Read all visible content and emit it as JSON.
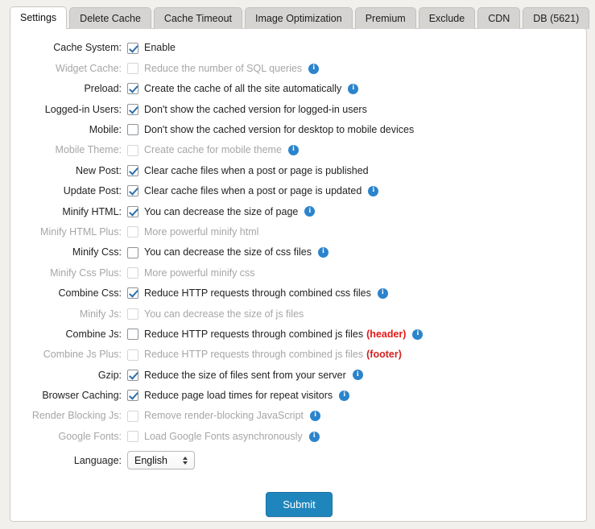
{
  "tabs": [
    {
      "label": "Settings",
      "active": true
    },
    {
      "label": "Delete Cache",
      "active": false
    },
    {
      "label": "Cache Timeout",
      "active": false
    },
    {
      "label": "Image Optimization",
      "active": false
    },
    {
      "label": "Premium",
      "active": false
    },
    {
      "label": "Exclude",
      "active": false
    },
    {
      "label": "CDN",
      "active": false
    },
    {
      "label": "DB (5621)",
      "active": false
    }
  ],
  "colors": {
    "accent": "#1f86bd",
    "info_icon": "#2b84cc",
    "checkmark": "#2d6ea8",
    "tag_header": "#e61717",
    "tag_footer": "#d22222",
    "page_background": "#f1f0ec",
    "panel_background": "#ffffff",
    "tab_inactive": "#d6d4d2"
  },
  "rows": [
    {
      "label": "Cache System:",
      "desc": "Enable",
      "checked": true,
      "disabled": false,
      "info": false
    },
    {
      "label": "Widget Cache:",
      "desc": "Reduce the number of SQL queries",
      "checked": false,
      "disabled": true,
      "info": true
    },
    {
      "label": "Preload:",
      "desc": "Create the cache of all the site automatically",
      "checked": true,
      "disabled": false,
      "info": true
    },
    {
      "label": "Logged-in Users:",
      "desc": "Don't show the cached version for logged-in users",
      "checked": true,
      "disabled": false,
      "info": false
    },
    {
      "label": "Mobile:",
      "desc": "Don't show the cached version for desktop to mobile devices",
      "checked": false,
      "disabled": false,
      "info": false
    },
    {
      "label": "Mobile Theme:",
      "desc": "Create cache for mobile theme",
      "checked": false,
      "disabled": true,
      "info": true
    },
    {
      "label": "New Post:",
      "desc": "Clear cache files when a post or page is published",
      "checked": true,
      "disabled": false,
      "info": false
    },
    {
      "label": "Update Post:",
      "desc": "Clear cache files when a post or page is updated",
      "checked": true,
      "disabled": false,
      "info": true
    },
    {
      "label": "Minify HTML:",
      "desc": "You can decrease the size of page",
      "checked": true,
      "disabled": false,
      "info": true
    },
    {
      "label": "Minify HTML Plus:",
      "desc": "More powerful minify html",
      "checked": false,
      "disabled": true,
      "info": false
    },
    {
      "label": "Minify Css:",
      "desc": "You can decrease the size of css files",
      "checked": false,
      "disabled": false,
      "info": true
    },
    {
      "label": "Minify Css Plus:",
      "desc": "More powerful minify css",
      "checked": false,
      "disabled": true,
      "info": false
    },
    {
      "label": "Combine Css:",
      "desc": "Reduce HTTP requests through combined css files",
      "checked": true,
      "disabled": false,
      "info": true
    },
    {
      "label": "Minify Js:",
      "desc": "You can decrease the size of js files",
      "checked": false,
      "disabled": true,
      "info": false
    },
    {
      "label": "Combine Js:",
      "desc": "Reduce HTTP requests through combined js files",
      "checked": false,
      "disabled": false,
      "info": true,
      "tag": "(header)",
      "tag_kind": "header"
    },
    {
      "label": "Combine Js Plus:",
      "desc": "Reduce HTTP requests through combined js files",
      "checked": false,
      "disabled": true,
      "info": false,
      "tag": "(footer)",
      "tag_kind": "footer"
    },
    {
      "label": "Gzip:",
      "desc": "Reduce the size of files sent from your server",
      "checked": true,
      "disabled": false,
      "info": true
    },
    {
      "label": "Browser Caching:",
      "desc": "Reduce page load times for repeat visitors",
      "checked": true,
      "disabled": false,
      "info": true
    },
    {
      "label": "Render Blocking Js:",
      "desc": "Remove render-blocking JavaScript",
      "checked": false,
      "disabled": true,
      "info": true
    },
    {
      "label": "Google Fonts:",
      "desc": "Load Google Fonts asynchronously",
      "checked": false,
      "disabled": true,
      "info": true
    }
  ],
  "language": {
    "label": "Language:",
    "value": "English",
    "options": [
      "English"
    ]
  },
  "submit": {
    "label": "Submit"
  },
  "icons": {
    "info": "i",
    "stepper_up": "triangle-up",
    "stepper_down": "triangle-down"
  }
}
